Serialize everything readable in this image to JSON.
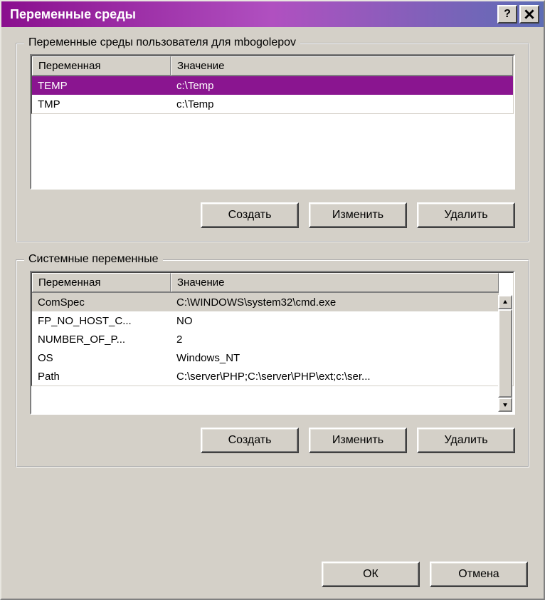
{
  "window": {
    "title": "Переменные среды"
  },
  "columns": {
    "var": "Переменная",
    "val": "Значение"
  },
  "user_group": {
    "legend": "Переменные среды пользователя для mbogolepov",
    "rows": [
      {
        "name": "TEMP",
        "value": "c:\\Temp",
        "selected": true
      },
      {
        "name": "TMP",
        "value": "c:\\Temp",
        "selected": false
      }
    ],
    "buttons": {
      "create": "Создать",
      "edit": "Изменить",
      "delete": "Удалить"
    }
  },
  "system_group": {
    "legend": "Системные переменные",
    "rows": [
      {
        "name": "ComSpec",
        "value": "C:\\WINDOWS\\system32\\cmd.exe",
        "grayed": true
      },
      {
        "name": "FP_NO_HOST_C...",
        "value": "NO"
      },
      {
        "name": "NUMBER_OF_P...",
        "value": "2"
      },
      {
        "name": "OS",
        "value": "Windows_NT"
      },
      {
        "name": "Path",
        "value": "C:\\server\\PHP;C:\\server\\PHP\\ext;c:\\ser..."
      }
    ],
    "buttons": {
      "create": "Создать",
      "edit": "Изменить",
      "delete": "Удалить"
    }
  },
  "dialog_buttons": {
    "ok": "ОК",
    "cancel": "Отмена"
  }
}
